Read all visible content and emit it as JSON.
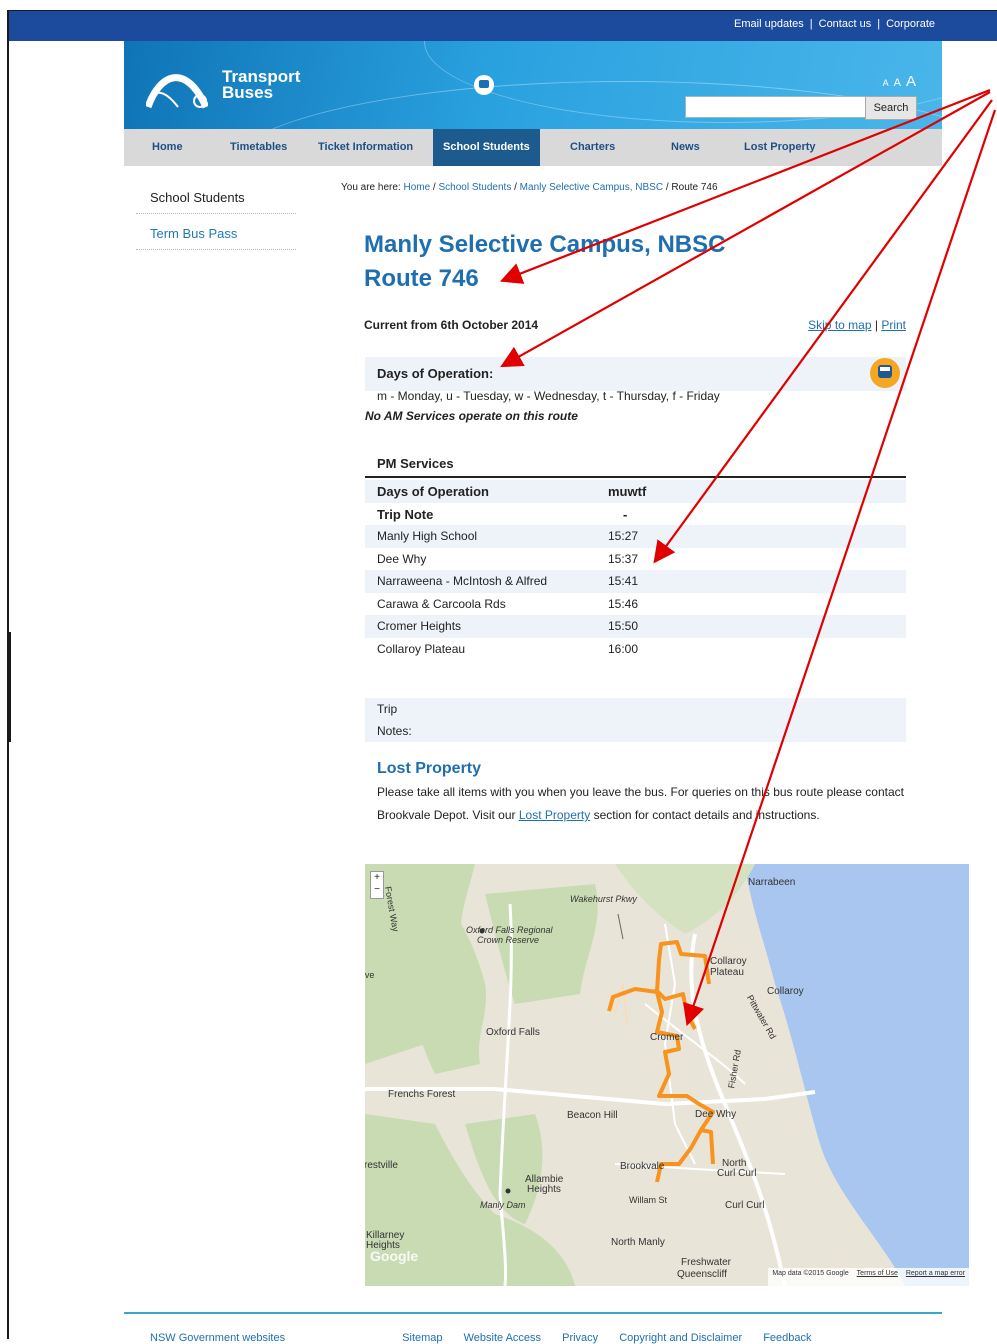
{
  "topbar": {
    "links": [
      "Email updates",
      "Contact us",
      "Corporate"
    ]
  },
  "brand": {
    "line1": "Transport",
    "line2": "Buses"
  },
  "font_sizes": [
    "A",
    "A",
    "A"
  ],
  "search": {
    "button": "Search",
    "placeholder": ""
  },
  "nav": [
    "Home",
    "Timetables",
    "Ticket Information",
    "School Students",
    "Charters",
    "News",
    "Lost Property"
  ],
  "sidebar": [
    "School Students",
    "Term Bus Pass"
  ],
  "breadcrumb": {
    "prefix": "You are here:",
    "items": [
      "Home",
      "School Students",
      "Manly Selective Campus, NBSC"
    ],
    "current": "Route 746"
  },
  "title": {
    "line1": "Manly Selective Campus, NBSC",
    "line2": "Route 746"
  },
  "current_from": "Current from 6th October 2014",
  "tools": {
    "map": "Skip to map",
    "print": "Print"
  },
  "days": {
    "title": "Days of Operation:",
    "legend": "m - Monday, u - Tuesday, w - Wednesday, t - Thursday, f - Friday",
    "no_am": "No AM Services operate on this route"
  },
  "pm": {
    "title": "PM Services",
    "header": {
      "label": "Days of Operation",
      "value": "muwtf"
    },
    "trip_note": {
      "label": "Trip Note",
      "value": "-"
    },
    "stops": [
      {
        "name": "Manly High School",
        "time": "15:27"
      },
      {
        "name": "Dee Why",
        "time": "15:37"
      },
      {
        "name": "Narraweena - McIntosh & Alfred",
        "time": "15:41"
      },
      {
        "name": "Carawa & Carcoola Rds",
        "time": "15:46"
      },
      {
        "name": "Cromer Heights",
        "time": "15:50"
      },
      {
        "name": "Collaroy Plateau",
        "time": "16:00"
      }
    ]
  },
  "trip_notes": {
    "line1": "Trip",
    "line2": "Notes:"
  },
  "lost_property": {
    "title": "Lost Property",
    "text1": "Please take all items with you when you leave the bus. For queries on this bus route please contact Brookvale Depot. Visit our ",
    "link": "Lost Property",
    "text2": " section for contact details and instructions."
  },
  "map": {
    "zoom_in": "+",
    "zoom_out": "−",
    "labels": {
      "narrabeen": "Narrabeen",
      "wakehurst": "Wakehurst Pkwy",
      "oxford_reserve1": "Oxford Falls Regional",
      "oxford_reserve2": "Crown Reserve",
      "collaroy_plateau1": "Collaroy",
      "collaroy_plateau2": "Plateau",
      "collaroy": "Collaroy",
      "oxford_falls": "Oxford Falls",
      "cromer": "Cromer",
      "frenchs_forest": "Frenchs Forest",
      "beacon_hill": "Beacon Hill",
      "dee_why": "Dee Why",
      "forestville": "restville",
      "brookvale": "Brookvale",
      "north_curl1": "North",
      "north_curl2": "Curl Curl",
      "allambie1": "Allambie",
      "allambie2": "Heights",
      "manly_dam": "Manly Dam",
      "curl_curl": "Curl Curl",
      "killarney1": "Killarney",
      "killarney2": "Heights",
      "north_manly": "North Manly",
      "freshwater": "Freshwater",
      "queenscliff": "Queenscliff",
      "ave": "Ave",
      "forest_way": "Forest Way",
      "fisher": "Fisher Rd",
      "pittwater": "Pittwater Rd",
      "wm_st": "Willam St",
      "google": "Google"
    },
    "footer": {
      "data": "Map data ©2015 Google",
      "terms": "Terms of Use",
      "report": "Report a map error"
    }
  },
  "footer": [
    "NSW Government websites",
    "Sitemap",
    "Website Access",
    "Privacy",
    "Copyright and Disclaimer",
    "Feedback"
  ],
  "colors": {
    "topbar": "#1c4a9c",
    "link": "#1f6fb0",
    "nav_active": "#1d5b8f",
    "route": "#f7931e",
    "annotation": "#e00000"
  }
}
